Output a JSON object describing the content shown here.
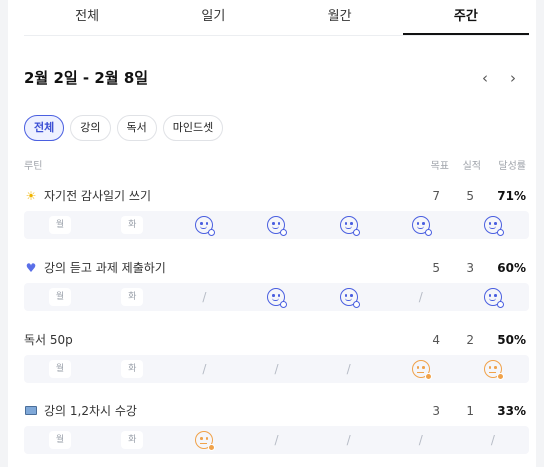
{
  "tabs": [
    "전체",
    "일기",
    "월간",
    "주간"
  ],
  "active_tab": 3,
  "date_range": "2월 2일 - 2월 8일",
  "nav": {
    "prev": "‹",
    "next": "›"
  },
  "chips": [
    "전체",
    "강의",
    "독서",
    "마인드셋"
  ],
  "active_chip": 0,
  "header": {
    "routine": "루틴",
    "goal": "목표",
    "actual": "실적",
    "rate": "달성률"
  },
  "routines": [
    {
      "icon": "sun-emoji",
      "title": "자기전 감사일기 쓰기",
      "goal": "7",
      "actual": "5",
      "rate": "71%",
      "days": [
        "월",
        "화",
        "blue",
        "blue",
        "blue",
        "blue",
        "blue"
      ]
    },
    {
      "icon": "heart-emoji",
      "title": "강의 듣고 과제 제출하기",
      "goal": "5",
      "actual": "3",
      "rate": "60%",
      "days": [
        "월",
        "화",
        "/",
        "blue",
        "blue",
        "/",
        "blue"
      ]
    },
    {
      "icon": "",
      "title": "독서 50p",
      "goal": "4",
      "actual": "2",
      "rate": "50%",
      "days": [
        "월",
        "화",
        "/",
        "/",
        "/",
        "orange",
        "orange"
      ]
    },
    {
      "icon": "laptop-emoji",
      "title": "강의 1,2차시 수강",
      "goal": "3",
      "actual": "1",
      "rate": "33%",
      "days": [
        "월",
        "화",
        "orange",
        "/",
        "/",
        "/",
        "/"
      ]
    }
  ],
  "colors": {
    "accent": "#4a5fe0",
    "warn": "#f0a24a",
    "row_bg": "#f5f6fa"
  }
}
